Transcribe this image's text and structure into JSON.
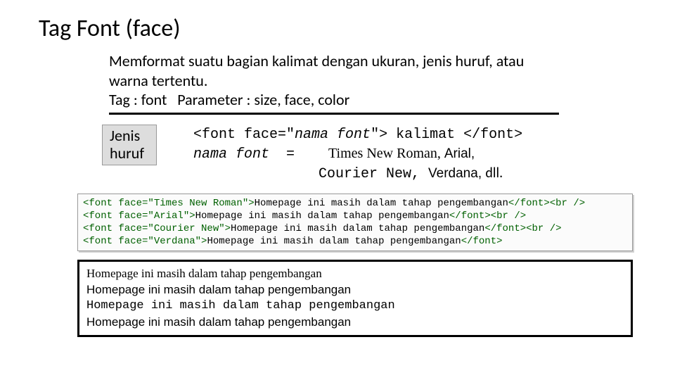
{
  "title": "Tag Font (face)",
  "description": {
    "line1": "Memformat suatu bagian kalimat dengan ukuran, jenis huruf, atau warna tertentu.",
    "line2": "Tag : font   Parameter : size, face, color"
  },
  "label": {
    "line1": "Jenis",
    "line2": "huruf"
  },
  "syntax": {
    "open1": "<font face=\"",
    "name_font": "nama font",
    "open2": "\"> kalimat </font>",
    "name_font2": "nama font",
    "equals": "  =    ",
    "examples_tnr": "Times New Roman, ",
    "examples_arial": "Arial,",
    "examples_courier": "Courier New, ",
    "examples_verdana": "Verdana, ",
    "examples_end": "dll."
  },
  "code": {
    "lines": [
      {
        "tag": "<font face=\"Times New Roman\">",
        "text": "Homepage ini masih dalam tahap pengembangan",
        "close": "</font><br />"
      },
      {
        "tag": "<font face=\"Arial\">",
        "text": "Homepage ini masih dalam tahap pengembangan",
        "close": "</font><br />"
      },
      {
        "tag": "<font face=\"Courier New\">",
        "text": "Homepage ini masih dalam tahap pengembangan",
        "close": "</font><br />"
      },
      {
        "tag": "<font face=\"Verdana\">",
        "text": "Homepage ini masih dalam tahap pengembangan",
        "close": "</font>"
      }
    ]
  },
  "output": {
    "tnr": "Homepage ini masih dalam tahap pengembangan",
    "arial": "Homepage ini masih dalam tahap pengembangan",
    "courier": "Homepage ini masih dalam tahap pengembangan",
    "verdana": "Homepage ini masih dalam tahap pengembangan"
  }
}
